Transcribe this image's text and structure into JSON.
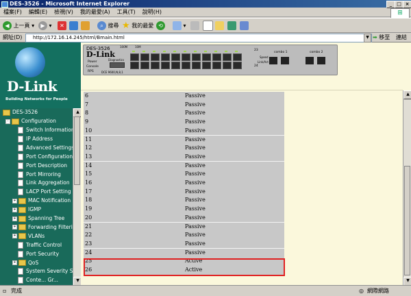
{
  "window": {
    "title": "DES-3526 - Microsoft Internet Explorer"
  },
  "menu": [
    "檔案(F)",
    "編輯(E)",
    "檢視(V)",
    "我的最愛(A)",
    "工具(T)",
    "說明(H)"
  ],
  "toolbar": {
    "back": "上一頁",
    "search": "搜尋",
    "favorites": "我的最愛"
  },
  "address": {
    "label": "網址(D)",
    "url": "http://172.16.14.245/html/Bmain.html",
    "go": "移至",
    "links": "連結"
  },
  "device": {
    "model": "DES-3526",
    "brand": "D-Link",
    "speed_10": "100M",
    "speed_100": "10M",
    "power": "Power",
    "console": "Console",
    "rps": "RPS",
    "diag": "Diagnostics",
    "dce": "DCE 9600,N,8,1",
    "combo1": "combo 1",
    "combo2": "combo 2",
    "port23": "23",
    "port24": "24",
    "link_act": "Link/Act",
    "speed": "Speed"
  },
  "sidebar": {
    "brand": "D-Link",
    "tagline": "Building Networks for People",
    "root": "DES-3526",
    "config": "Configuration",
    "items": [
      {
        "label": "Switch Information",
        "expandable": false
      },
      {
        "label": "IP Address",
        "expandable": false
      },
      {
        "label": "Advanced Settings",
        "expandable": false
      },
      {
        "label": "Port Configuration",
        "expandable": false
      },
      {
        "label": "Port Description",
        "expandable": false
      },
      {
        "label": "Port Mirroring",
        "expandable": false
      },
      {
        "label": "Link Aggregation",
        "expandable": false
      },
      {
        "label": "LACP Port Setting",
        "expandable": false
      },
      {
        "label": "MAC Notification",
        "expandable": true
      },
      {
        "label": "IGMP",
        "expandable": true
      },
      {
        "label": "Spanning Tree",
        "expandable": true
      },
      {
        "label": "Forwarding Filtering",
        "expandable": true
      },
      {
        "label": "VLANs",
        "expandable": true
      },
      {
        "label": "Traffic Control",
        "expandable": false
      },
      {
        "label": "Port Security",
        "expandable": false
      },
      {
        "label": "QoS",
        "expandable": true
      },
      {
        "label": "System Severity Setti",
        "expandable": false
      },
      {
        "label": "Conte... Gr...",
        "expandable": false
      }
    ]
  },
  "ports": [
    {
      "port": "6",
      "mode": "Passive"
    },
    {
      "port": "7",
      "mode": "Passive"
    },
    {
      "port": "8",
      "mode": "Passive"
    },
    {
      "port": "9",
      "mode": "Passive"
    },
    {
      "port": "10",
      "mode": "Passive"
    },
    {
      "port": "11",
      "mode": "Passive"
    },
    {
      "port": "12",
      "mode": "Passive"
    },
    {
      "port": "13",
      "mode": "Passive"
    },
    {
      "port": "14",
      "mode": "Passive"
    },
    {
      "port": "15",
      "mode": "Passive"
    },
    {
      "port": "16",
      "mode": "Passive"
    },
    {
      "port": "17",
      "mode": "Passive"
    },
    {
      "port": "18",
      "mode": "Passive"
    },
    {
      "port": "19",
      "mode": "Passive"
    },
    {
      "port": "20",
      "mode": "Passive"
    },
    {
      "port": "21",
      "mode": "Passive"
    },
    {
      "port": "22",
      "mode": "Passive"
    },
    {
      "port": "23",
      "mode": "Passive"
    },
    {
      "port": "24",
      "mode": "Passive"
    },
    {
      "port": "25",
      "mode": "Active"
    },
    {
      "port": "26",
      "mode": "Active"
    }
  ],
  "status": {
    "left": "完成",
    "right": "網際網路"
  }
}
